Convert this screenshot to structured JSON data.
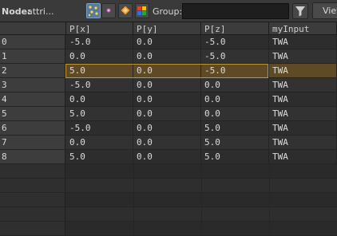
{
  "toolbar": {
    "node_label": "Node:",
    "node_value": "attri...",
    "group_label": "Group:",
    "group_value": "",
    "view_label": "View"
  },
  "columns": [
    "P[x]",
    "P[y]",
    "P[z]",
    "myInput"
  ],
  "rows": [
    {
      "index": "0",
      "px": "-5.0",
      "py": "0.0",
      "pz": "-5.0",
      "myInput": "TWA"
    },
    {
      "index": "1",
      "px": "0.0",
      "py": "0.0",
      "pz": "-5.0",
      "myInput": "TWA"
    },
    {
      "index": "2",
      "px": "5.0",
      "py": "0.0",
      "pz": "-5.0",
      "myInput": "TWA"
    },
    {
      "index": "3",
      "px": "-5.0",
      "py": "0.0",
      "pz": "0.0",
      "myInput": "TWA"
    },
    {
      "index": "4",
      "px": "0.0",
      "py": "0.0",
      "pz": "0.0",
      "myInput": "TWA"
    },
    {
      "index": "5",
      "px": "5.0",
      "py": "0.0",
      "pz": "0.0",
      "myInput": "TWA"
    },
    {
      "index": "6",
      "px": "-5.0",
      "py": "0.0",
      "pz": "5.0",
      "myInput": "TWA"
    },
    {
      "index": "7",
      "px": "0.0",
      "py": "0.0",
      "pz": "5.0",
      "myInput": "TWA"
    },
    {
      "index": "8",
      "px": "5.0",
      "py": "0.0",
      "pz": "5.0",
      "myInput": "TWA"
    }
  ],
  "selected_row": "2",
  "colors": {
    "selection_fill": "#5e4a25",
    "selection_border": "#c09636",
    "active_button": "#5a7a9a"
  },
  "icons": [
    "points-icon",
    "vertices-icon",
    "primitives-icon",
    "detail-icon",
    "filter-icon"
  ]
}
